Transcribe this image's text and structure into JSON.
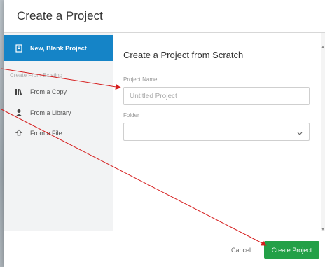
{
  "dialog": {
    "title": "Create a Project"
  },
  "sidebar": {
    "items": [
      {
        "label": "New, Blank Project",
        "icon": "blank-document-icon",
        "active": true
      },
      {
        "label": "From a Copy",
        "icon": "books-icon",
        "active": false
      },
      {
        "label": "From a Library",
        "icon": "library-user-icon",
        "active": false
      },
      {
        "label": "From a File",
        "icon": "upload-icon",
        "active": false
      }
    ],
    "heading": "Create From Existing"
  },
  "main": {
    "title": "Create a Project from Scratch",
    "project_name_label": "Project Name",
    "project_name_placeholder": "Untitled Project",
    "project_name_value": "",
    "folder_label": "Folder",
    "folder_value": ""
  },
  "footer": {
    "cancel_label": "Cancel",
    "create_label": "Create Project"
  },
  "colors": {
    "active_item": "#1584c7",
    "create_button": "#23a047",
    "annotation_arrow": "#d61f1f"
  }
}
